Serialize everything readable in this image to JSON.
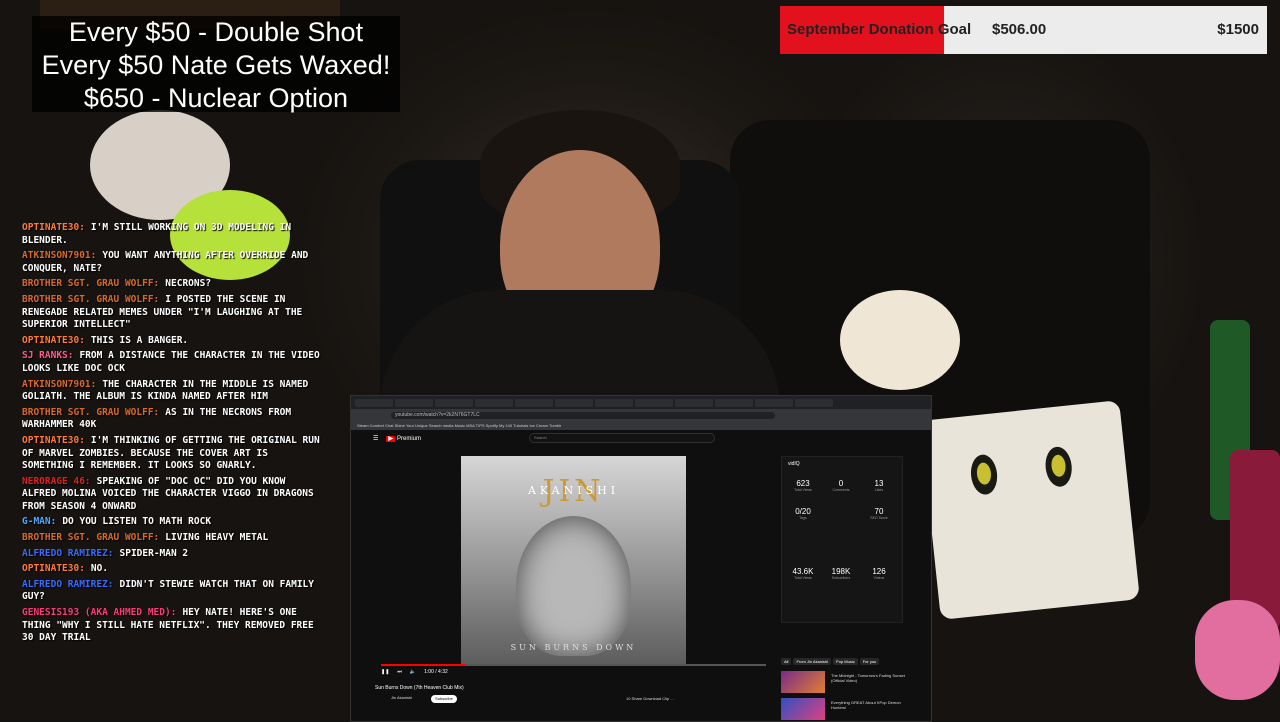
{
  "overlay": {
    "rules": [
      "Every $50 - Double Shot",
      "Every $50 Nate Gets Waxed!",
      "$650 - Nuclear Option"
    ],
    "donation_goal": {
      "title": "September Donation Goal",
      "current": "$506.00",
      "target": "$1500",
      "progress_fraction": 0.337,
      "fill_color": "#e3111e"
    }
  },
  "chat": {
    "messages": [
      {
        "user": "optinate30:",
        "color": "#ff7a3a",
        "text": "I'm still working on 3D modeling in Blender."
      },
      {
        "user": "atkinson7901:",
        "color": "#d86a2c",
        "text": "You want anything after Override and Conquer, Nate?"
      },
      {
        "user": "Brother Sgt. Grau Wolff:",
        "color": "#d86a2c",
        "text": "Necrons?"
      },
      {
        "user": "Brother Sgt. Grau Wolff:",
        "color": "#d86a2c",
        "text": "I posted the scene in Renegade Related Memes under \"I'm Laughing At The Superior Intellect\""
      },
      {
        "user": "optinate30:",
        "color": "#ff7a3a",
        "text": "This is a banger."
      },
      {
        "user": "SJ RANKS:",
        "color": "#ff5a8a",
        "text": "From a distance the character in the video looks like Doc Ock"
      },
      {
        "user": "atkinson7901:",
        "color": "#d86a2c",
        "text": "The character in the middle is named Goliath. the album is kinda named after him"
      },
      {
        "user": "Brother Sgt. Grau Wolff:",
        "color": "#d86a2c",
        "text": "As in the Necrons from Warhammer 40k"
      },
      {
        "user": "optinate30:",
        "color": "#ff7a3a",
        "text": "I'm thinking of getting the original run of Marvel Zombies. Because the cover art is something I remember. It looks so gnarly."
      },
      {
        "user": "NeroRage 46:",
        "color": "#e02020",
        "text": "Speaking of \"Doc Oc\" did you know Alfred Molina voiced the character Viggo in Dragons from season 4 onward"
      },
      {
        "user": "G-man:",
        "color": "#4aa8ff",
        "text": "do you listen to math rock"
      },
      {
        "user": "Brother Sgt. Grau Wolff:",
        "color": "#d86a2c",
        "text": "Living heavy Metal"
      },
      {
        "user": "Alfredo Ramirez:",
        "color": "#3a6aff",
        "text": "Spider-Man 2"
      },
      {
        "user": "optinate30:",
        "color": "#ff7a3a",
        "text": "No."
      },
      {
        "user": "Alfredo Ramirez:",
        "color": "#3a6aff",
        "text": "Didn't Stewie watch that on Family Guy?"
      },
      {
        "user": "Genesis193 (aka Ahmed Med):",
        "color": "#ff3a7a",
        "text": "Hey Nate! Here's one thing \"Why I still hate Netflix\". They removed free 30 day trial"
      }
    ]
  },
  "browser": {
    "url": "youtube.com/watch?v=2k2N76GT7LC",
    "bookmarks": "Steam Comfort Chat   Shine Your Unique   Search media Music   MSA TIPS   Spotify   My 140 Tutorials   Ice Cream   Tumblr",
    "yt_logo": "Premium",
    "search_placeholder": "Search",
    "video": {
      "artist_art": "JIN",
      "artist_sub": "AKANISHI",
      "album_footer": "SUN BURNS DOWN",
      "time": "1:00 / 4:32",
      "progress_fraction": 0.22,
      "title": "Sun Burns Down (7th Heaven Club Mix)",
      "channel": "Jin Akanishi",
      "subscribe": "Subscribe",
      "actions": "10   Share   Download   Clip   ..."
    },
    "panel": {
      "brand": "vidIQ",
      "stats": [
        {
          "value": "623",
          "label": "Total Views"
        },
        {
          "value": "0",
          "label": "Comments"
        },
        {
          "value": "13",
          "label": "Likes"
        },
        {
          "value": "0/20",
          "label": "Tags"
        },
        {
          "value": "70",
          "label": "SEO Score"
        },
        {
          "value": "43.6K",
          "label": "Total Views"
        },
        {
          "value": "198K",
          "label": "Subscribers"
        },
        {
          "value": "126",
          "label": "Videos"
        }
      ]
    },
    "chips": [
      "All",
      "From Jin Akanishi",
      "Pop Music",
      "For you"
    ],
    "recommendations": [
      "The Midnight - Tomorrow's Fading Sunset (Official Video)",
      "Everything GREAT About KPop Demon Hunters!"
    ]
  }
}
